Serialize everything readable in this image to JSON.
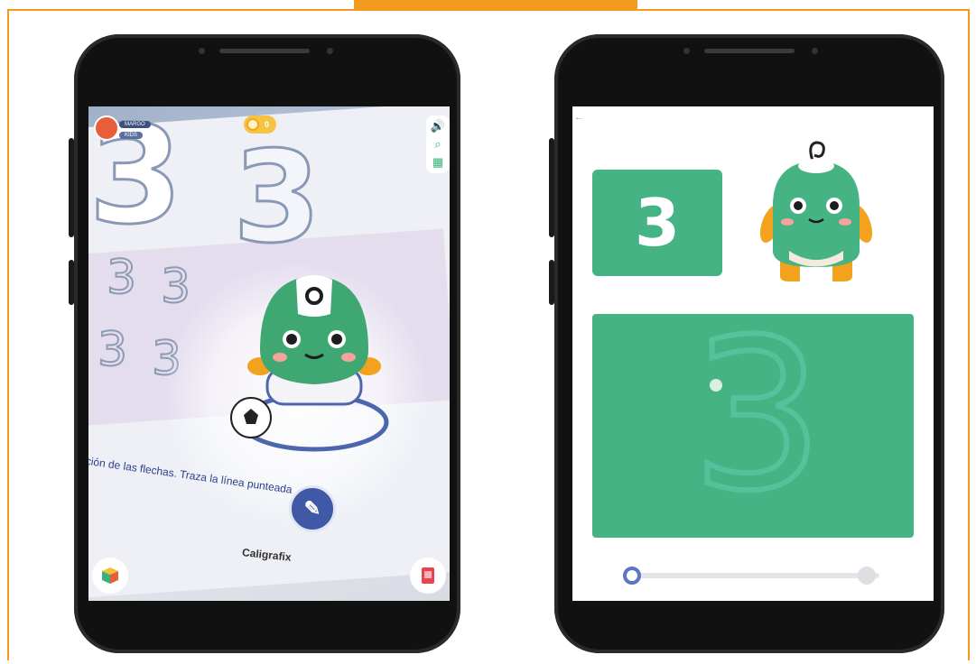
{
  "left_phone": {
    "hud": {
      "player_name": "MARGO",
      "player_tag": "KIDS",
      "coin_count": "0",
      "tools": [
        "speaker-icon",
        "search-icon",
        "map-icon"
      ]
    },
    "book": {
      "instruction": "dirección de las flechas. Traza la línea punteada",
      "brand": "Caligrafix",
      "digit": "3"
    }
  },
  "right_phone": {
    "card_digit": "3",
    "trace_digit": "3",
    "progress": 0.0
  },
  "colors": {
    "accent": "#45b383",
    "frame": "#f39a1e",
    "knob": "#5b77c4"
  }
}
